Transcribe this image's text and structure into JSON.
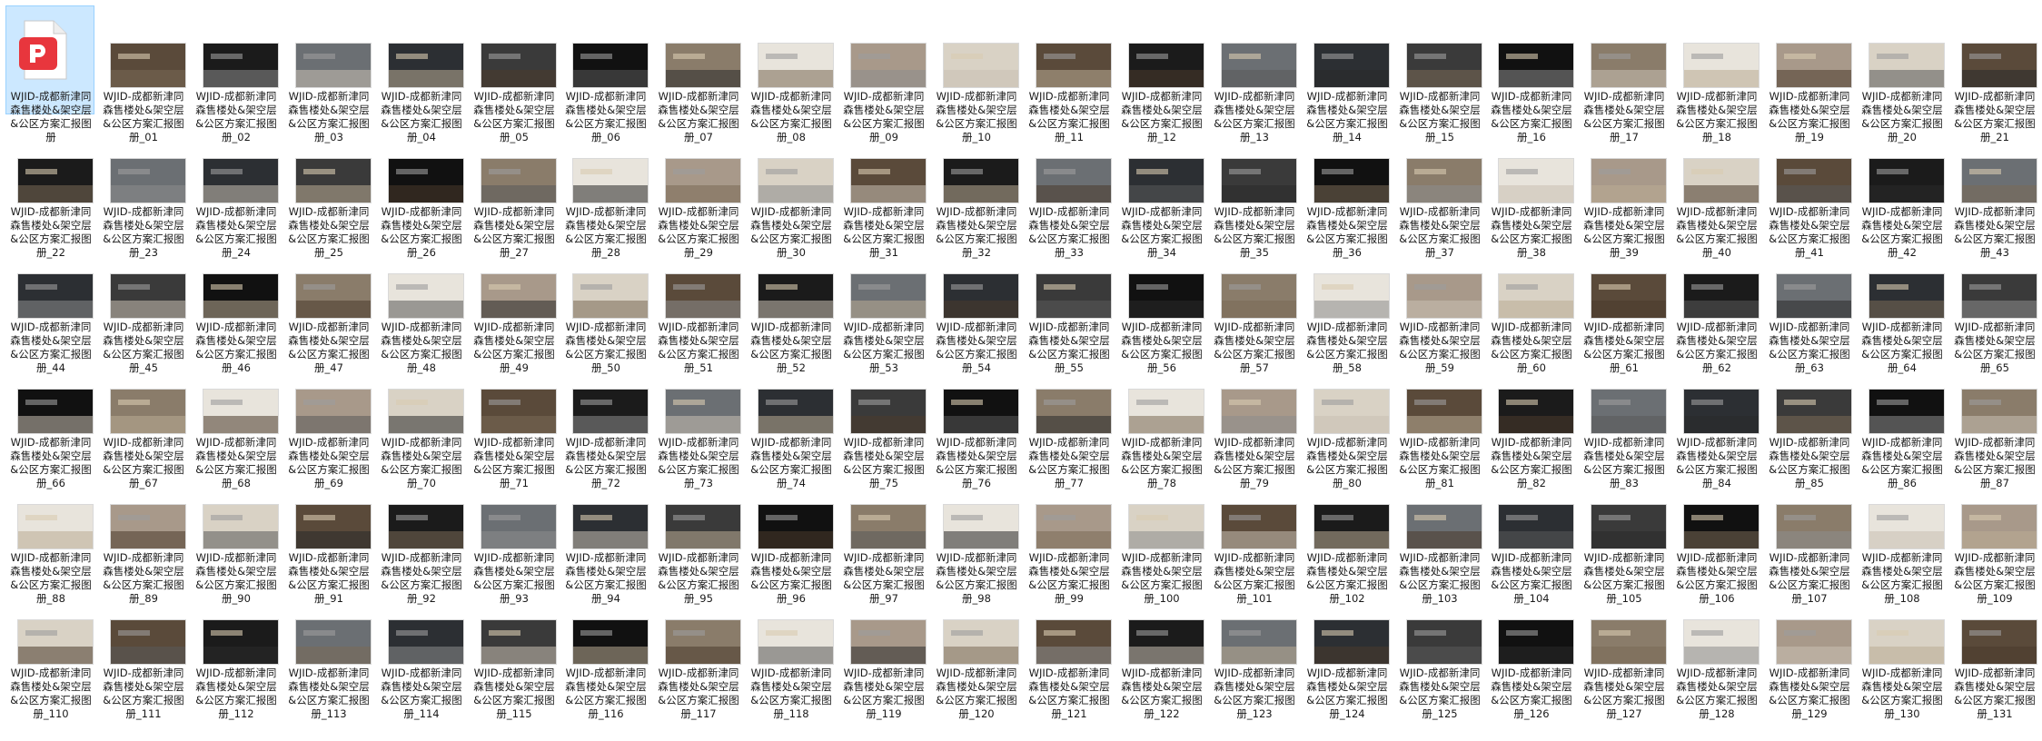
{
  "explorer": {
    "name_prefix": "WJID-成都新津同森售楼处&架空层&公区方案汇报图册",
    "colors": {
      "selection_bg": "#cce8ff",
      "selection_border": "#99d1ff",
      "pdf_red": "#e8363d"
    },
    "first_file": {
      "label": "WJID-成都新津同森售楼处&架空层&公区方案汇报图册",
      "icon": "pdf-file-icon",
      "selected": true
    },
    "image_files": [
      "WJID-成都新津同森售楼处&架空层&公区方案汇报图册_01",
      "WJID-成都新津同森售楼处&架空层&公区方案汇报图册_02",
      "WJID-成都新津同森售楼处&架空层&公区方案汇报图册_03",
      "WJID-成都新津同森售楼处&架空层&公区方案汇报图册_04",
      "WJID-成都新津同森售楼处&架空层&公区方案汇报图册_05",
      "WJID-成都新津同森售楼处&架空层&公区方案汇报图册_06",
      "WJID-成都新津同森售楼处&架空层&公区方案汇报图册_07",
      "WJID-成都新津同森售楼处&架空层&公区方案汇报图册_08",
      "WJID-成都新津同森售楼处&架空层&公区方案汇报图册_09",
      "WJID-成都新津同森售楼处&架空层&公区方案汇报图册_10",
      "WJID-成都新津同森售楼处&架空层&公区方案汇报图册_11",
      "WJID-成都新津同森售楼处&架空层&公区方案汇报图册_12",
      "WJID-成都新津同森售楼处&架空层&公区方案汇报图册_13",
      "WJID-成都新津同森售楼处&架空层&公区方案汇报图册_14",
      "WJID-成都新津同森售楼处&架空层&公区方案汇报图册_15",
      "WJID-成都新津同森售楼处&架空层&公区方案汇报图册_16",
      "WJID-成都新津同森售楼处&架空层&公区方案汇报图册_17",
      "WJID-成都新津同森售楼处&架空层&公区方案汇报图册_18",
      "WJID-成都新津同森售楼处&架空层&公区方案汇报图册_19",
      "WJID-成都新津同森售楼处&架空层&公区方案汇报图册_20",
      "WJID-成都新津同森售楼处&架空层&公区方案汇报图册_21",
      "WJID-成都新津同森售楼处&架空层&公区方案汇报图册_22",
      "WJID-成都新津同森售楼处&架空层&公区方案汇报图册_23",
      "WJID-成都新津同森售楼处&架空层&公区方案汇报图册_24",
      "WJID-成都新津同森售楼处&架空层&公区方案汇报图册_25",
      "WJID-成都新津同森售楼处&架空层&公区方案汇报图册_26",
      "WJID-成都新津同森售楼处&架空层&公区方案汇报图册_27",
      "WJID-成都新津同森售楼处&架空层&公区方案汇报图册_28",
      "WJID-成都新津同森售楼处&架空层&公区方案汇报图册_29",
      "WJID-成都新津同森售楼处&架空层&公区方案汇报图册_30",
      "WJID-成都新津同森售楼处&架空层&公区方案汇报图册_31",
      "WJID-成都新津同森售楼处&架空层&公区方案汇报图册_32",
      "WJID-成都新津同森售楼处&架空层&公区方案汇报图册_33",
      "WJID-成都新津同森售楼处&架空层&公区方案汇报图册_34",
      "WJID-成都新津同森售楼处&架空层&公区方案汇报图册_35",
      "WJID-成都新津同森售楼处&架空层&公区方案汇报图册_36",
      "WJID-成都新津同森售楼处&架空层&公区方案汇报图册_37",
      "WJID-成都新津同森售楼处&架空层&公区方案汇报图册_38",
      "WJID-成都新津同森售楼处&架空层&公区方案汇报图册_39",
      "WJID-成都新津同森售楼处&架空层&公区方案汇报图册_40",
      "WJID-成都新津同森售楼处&架空层&公区方案汇报图册_41",
      "WJID-成都新津同森售楼处&架空层&公区方案汇报图册_42",
      "WJID-成都新津同森售楼处&架空层&公区方案汇报图册_43",
      "WJID-成都新津同森售楼处&架空层&公区方案汇报图册_44",
      "WJID-成都新津同森售楼处&架空层&公区方案汇报图册_45",
      "WJID-成都新津同森售楼处&架空层&公区方案汇报图册_46",
      "WJID-成都新津同森售楼处&架空层&公区方案汇报图册_47",
      "WJID-成都新津同森售楼处&架空层&公区方案汇报图册_48",
      "WJID-成都新津同森售楼处&架空层&公区方案汇报图册_49",
      "WJID-成都新津同森售楼处&架空层&公区方案汇报图册_50",
      "WJID-成都新津同森售楼处&架空层&公区方案汇报图册_51",
      "WJID-成都新津同森售楼处&架空层&公区方案汇报图册_52",
      "WJID-成都新津同森售楼处&架空层&公区方案汇报图册_53",
      "WJID-成都新津同森售楼处&架空层&公区方案汇报图册_54",
      "WJID-成都新津同森售楼处&架空层&公区方案汇报图册_55",
      "WJID-成都新津同森售楼处&架空层&公区方案汇报图册_56",
      "WJID-成都新津同森售楼处&架空层&公区方案汇报图册_57",
      "WJID-成都新津同森售楼处&架空层&公区方案汇报图册_58",
      "WJID-成都新津同森售楼处&架空层&公区方案汇报图册_59",
      "WJID-成都新津同森售楼处&架空层&公区方案汇报图册_60",
      "WJID-成都新津同森售楼处&架空层&公区方案汇报图册_61",
      "WJID-成都新津同森售楼处&架空层&公区方案汇报图册_62",
      "WJID-成都新津同森售楼处&架空层&公区方案汇报图册_63",
      "WJID-成都新津同森售楼处&架空层&公区方案汇报图册_64",
      "WJID-成都新津同森售楼处&架空层&公区方案汇报图册_65",
      "WJID-成都新津同森售楼处&架空层&公区方案汇报图册_66",
      "WJID-成都新津同森售楼处&架空层&公区方案汇报图册_67",
      "WJID-成都新津同森售楼处&架空层&公区方案汇报图册_68",
      "WJID-成都新津同森售楼处&架空层&公区方案汇报图册_69",
      "WJID-成都新津同森售楼处&架空层&公区方案汇报图册_70",
      "WJID-成都新津同森售楼处&架空层&公区方案汇报图册_71",
      "WJID-成都新津同森售楼处&架空层&公区方案汇报图册_72",
      "WJID-成都新津同森售楼处&架空层&公区方案汇报图册_73",
      "WJID-成都新津同森售楼处&架空层&公区方案汇报图册_74",
      "WJID-成都新津同森售楼处&架空层&公区方案汇报图册_75",
      "WJID-成都新津同森售楼处&架空层&公区方案汇报图册_76",
      "WJID-成都新津同森售楼处&架空层&公区方案汇报图册_77",
      "WJID-成都新津同森售楼处&架空层&公区方案汇报图册_78",
      "WJID-成都新津同森售楼处&架空层&公区方案汇报图册_79",
      "WJID-成都新津同森售楼处&架空层&公区方案汇报图册_80",
      "WJID-成都新津同森售楼处&架空层&公区方案汇报图册_81",
      "WJID-成都新津同森售楼处&架空层&公区方案汇报图册_82",
      "WJID-成都新津同森售楼处&架空层&公区方案汇报图册_83",
      "WJID-成都新津同森售楼处&架空层&公区方案汇报图册_84",
      "WJID-成都新津同森售楼处&架空层&公区方案汇报图册_85",
      "WJID-成都新津同森售楼处&架空层&公区方案汇报图册_86",
      "WJID-成都新津同森售楼处&架空层&公区方案汇报图册_87",
      "WJID-成都新津同森售楼处&架空层&公区方案汇报图册_88",
      "WJID-成都新津同森售楼处&架空层&公区方案汇报图册_89",
      "WJID-成都新津同森售楼处&架空层&公区方案汇报图册_90",
      "WJID-成都新津同森售楼处&架空层&公区方案汇报图册_91",
      "WJID-成都新津同森售楼处&架空层&公区方案汇报图册_92",
      "WJID-成都新津同森售楼处&架空层&公区方案汇报图册_93",
      "WJID-成都新津同森售楼处&架空层&公区方案汇报图册_94",
      "WJID-成都新津同森售楼处&架空层&公区方案汇报图册_95",
      "WJID-成都新津同森售楼处&架空层&公区方案汇报图册_96",
      "WJID-成都新津同森售楼处&架空层&公区方案汇报图册_97",
      "WJID-成都新津同森售楼处&架空层&公区方案汇报图册_98",
      "WJID-成都新津同森售楼处&架空层&公区方案汇报图册_99",
      "WJID-成都新津同森售楼处&架空层&公区方案汇报图册_100",
      "WJID-成都新津同森售楼处&架空层&公区方案汇报图册_101",
      "WJID-成都新津同森售楼处&架空层&公区方案汇报图册_102",
      "WJID-成都新津同森售楼处&架空层&公区方案汇报图册_103",
      "WJID-成都新津同森售楼处&架空层&公区方案汇报图册_104",
      "WJID-成都新津同森售楼处&架空层&公区方案汇报图册_105",
      "WJID-成都新津同森售楼处&架空层&公区方案汇报图册_106",
      "WJID-成都新津同森售楼处&架空层&公区方案汇报图册_107",
      "WJID-成都新津同森售楼处&架空层&公区方案汇报图册_108",
      "WJID-成都新津同森售楼处&架空层&公区方案汇报图册_109",
      "WJID-成都新津同森售楼处&架空层&公区方案汇报图册_110",
      "WJID-成都新津同森售楼处&架空层&公区方案汇报图册_111",
      "WJID-成都新津同森售楼处&架空层&公区方案汇报图册_112",
      "WJID-成都新津同森售楼处&架空层&公区方案汇报图册_113",
      "WJID-成都新津同森售楼处&架空层&公区方案汇报图册_114",
      "WJID-成都新津同森售楼处&架空层&公区方案汇报图册_115",
      "WJID-成都新津同森售楼处&架空层&公区方案汇报图册_116",
      "WJID-成都新津同森售楼处&架空层&公区方案汇报图册_117",
      "WJID-成都新津同森售楼处&架空层&公区方案汇报图册_118",
      "WJID-成都新津同森售楼处&架空层&公区方案汇报图册_119",
      "WJID-成都新津同森售楼处&架空层&公区方案汇报图册_120",
      "WJID-成都新津同森售楼处&架空层&公区方案汇报图册_121",
      "WJID-成都新津同森售楼处&架空层&公区方案汇报图册_122",
      "WJID-成都新津同森售楼处&架空层&公区方案汇报图册_123",
      "WJID-成都新津同森售楼处&架空层&公区方案汇报图册_124",
      "WJID-成都新津同森售楼处&架空层&公区方案汇报图册_125",
      "WJID-成都新津同森售楼处&架空层&公区方案汇报图册_126",
      "WJID-成都新津同森售楼处&架空层&公区方案汇报图册_127",
      "WJID-成都新津同森售楼处&架空层&公区方案汇报图册_128",
      "WJID-成都新津同森售楼处&架空层&公区方案汇报图册_129",
      "WJID-成都新津同森售楼处&架空层&公区方案汇报图册_130",
      "WJID-成都新津同森售楼处&架空层&公区方案汇报图册_131"
    ],
    "thumb_icon": "image-thumbnail-icon"
  }
}
